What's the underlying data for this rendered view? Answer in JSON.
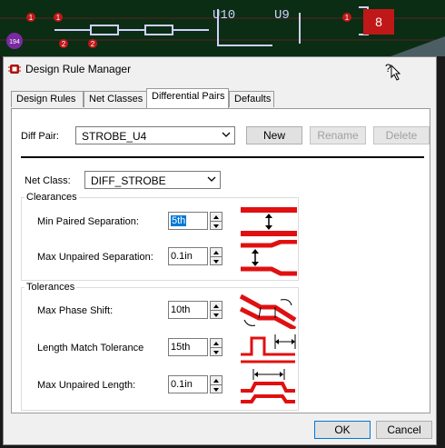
{
  "pcb": {
    "pin_labels": [
      "8",
      "1",
      "1",
      "2",
      "2",
      "1",
      "194"
    ],
    "silk_labels": [
      "U10",
      "U9"
    ]
  },
  "window": {
    "title": "Design Rule Manager",
    "help_label": "?"
  },
  "tabs": [
    {
      "label": "Design Rules",
      "active": false
    },
    {
      "label": "Net Classes",
      "active": false
    },
    {
      "label": "Differential Pairs",
      "active": true
    },
    {
      "label": "Defaults",
      "active": false
    }
  ],
  "diff_pair": {
    "label": "Diff Pair:",
    "selected": "STROBE_U4",
    "new_label": "New",
    "rename_label": "Rename",
    "delete_label": "Delete"
  },
  "net_class": {
    "label": "Net Class:",
    "selected": "DIFF_STROBE"
  },
  "clearances": {
    "title": "Clearances",
    "min_paired_label": "Min Paired Separation:",
    "min_paired_value": "5th",
    "max_unpaired_label": "Max Unpaired Separation:",
    "max_unpaired_value": "0.1in"
  },
  "tolerances": {
    "title": "Tolerances",
    "phase_label": "Max Phase Shift:",
    "phase_value": "10th",
    "length_match_label": "Length Match Tolerance",
    "length_match_value": "15th",
    "unpaired_length_label": "Max Unpaired Length:",
    "unpaired_length_value": "0.1in"
  },
  "footer": {
    "ok_label": "OK",
    "cancel_label": "Cancel"
  },
  "colors": {
    "accent": "#0078d7",
    "diagram_red": "#e01010",
    "pcb_bg": "#0a3a18",
    "pcb_trace": "#c8c8ff"
  }
}
